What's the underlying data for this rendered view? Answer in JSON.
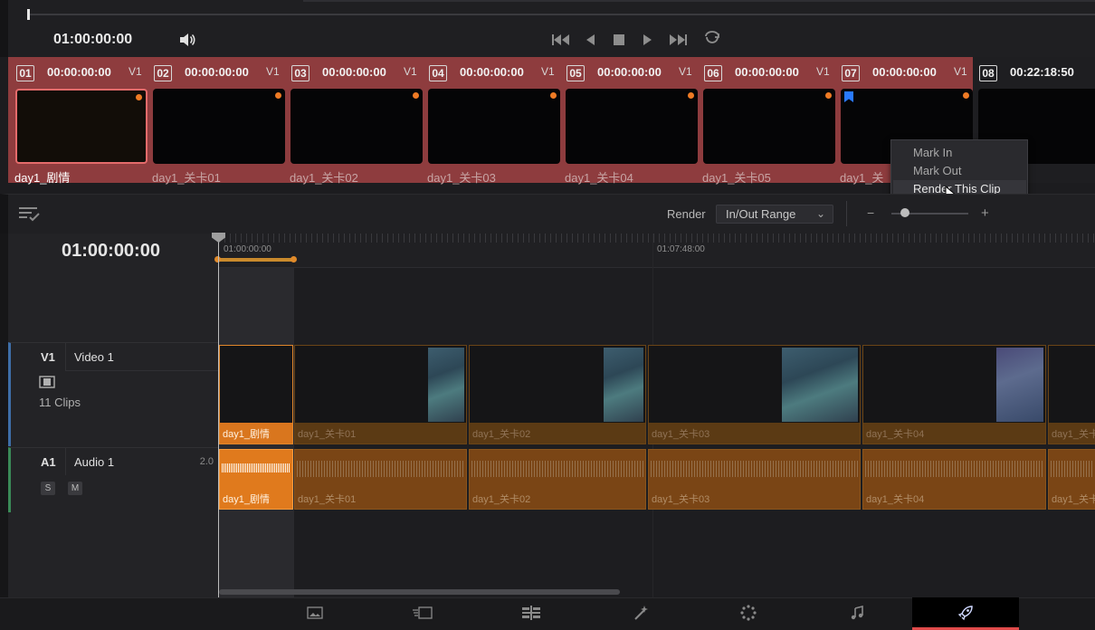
{
  "viewer": {
    "timecode": "01:00:00:00"
  },
  "clips": [
    {
      "num": "01",
      "timecode": "00:00:00:00",
      "track": "V1",
      "name": "day1_剧情",
      "selected": true
    },
    {
      "num": "02",
      "timecode": "00:00:00:00",
      "track": "V1",
      "name": "day1_关卡01"
    },
    {
      "num": "03",
      "timecode": "00:00:00:00",
      "track": "V1",
      "name": "day1_关卡02"
    },
    {
      "num": "04",
      "timecode": "00:00:00:00",
      "track": "V1",
      "name": "day1_关卡03"
    },
    {
      "num": "05",
      "timecode": "00:00:00:00",
      "track": "V1",
      "name": "day1_关卡04"
    },
    {
      "num": "06",
      "timecode": "00:00:00:00",
      "track": "V1",
      "name": "day1_关卡05"
    },
    {
      "num": "07",
      "timecode": "00:00:00:00",
      "track": "V1",
      "name": "day1_关"
    },
    {
      "num": "08",
      "timecode": "00:22:18:50",
      "track": "",
      "name": ""
    }
  ],
  "context_menu": {
    "items": [
      "Mark In",
      "Mark Out",
      "Render This Clip"
    ]
  },
  "render_bar": {
    "label": "Render",
    "mode": "In/Out Range",
    "zoom_minus": "−",
    "zoom_plus": "+"
  },
  "timeline": {
    "timecode": "01:00:00:00",
    "ruler": [
      "01:00:00:00",
      "01:07:48:00"
    ],
    "tracks": {
      "video": {
        "id": "V1",
        "name": "Video 1",
        "clip_count": "11 Clips"
      },
      "audio": {
        "id": "A1",
        "name": "Audio 1",
        "channels": "2.0",
        "solo": "S",
        "mute": "M"
      }
    },
    "video_clips": [
      "day1_剧情",
      "day1_关卡01",
      "day1_关卡02",
      "day1_关卡03",
      "day1_关卡04",
      "day1_关卡"
    ],
    "audio_clips": [
      "day1_剧情",
      "day1_关卡01",
      "day1_关卡02",
      "day1_关卡03",
      "day1_关卡04",
      "day1_关卡"
    ]
  },
  "pages": [
    {
      "name": "media-page",
      "icon": "media-icon"
    },
    {
      "name": "cut-page",
      "icon": "cut-icon"
    },
    {
      "name": "edit-page",
      "icon": "edit-icon"
    },
    {
      "name": "fusion-page",
      "icon": "fusion-icon"
    },
    {
      "name": "color-page",
      "icon": "color-icon"
    },
    {
      "name": "fairlight-page",
      "icon": "music-note-icon"
    },
    {
      "name": "deliver-page",
      "icon": "rocket-icon",
      "active": true
    }
  ],
  "colors": {
    "strip": "#8e3c3e",
    "selection_border": "#e46b6b",
    "clip_orange": "#e07a1d",
    "flag_blue": "#2979ff",
    "active_page_accent": "#e04a4a"
  }
}
